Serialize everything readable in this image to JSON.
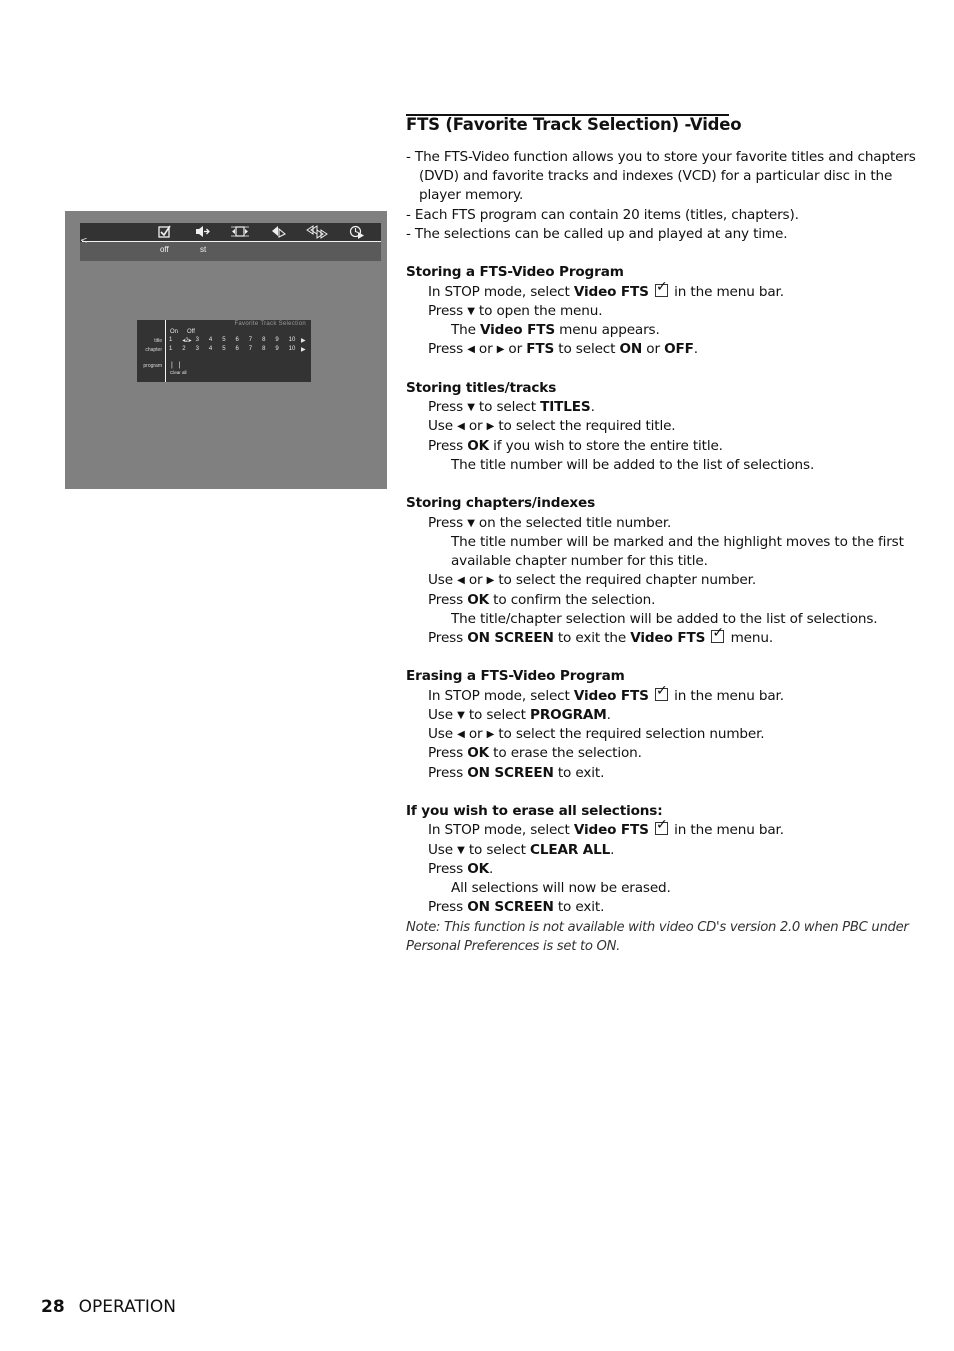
{
  "tv_screen": {
    "menubar": {
      "icons": [
        {
          "name": "video-fts-icon",
          "glyph": "☑",
          "label": "off"
        },
        {
          "name": "sound-icon",
          "glyph": "◀▸",
          "label": "st"
        },
        {
          "name": "frame-icon",
          "glyph": "◂□▸",
          "label": ""
        },
        {
          "name": "angle-icon",
          "glyph": "◀▷",
          "label": ""
        },
        {
          "name": "scan-icon",
          "glyph": "⟪⟫",
          "label": ""
        },
        {
          "name": "time-search-icon",
          "glyph": "◷",
          "label": ""
        }
      ],
      "back_arrow": "<"
    },
    "fts_panel": {
      "heading": "Favorite Track Selection",
      "on_label": "On",
      "off_label": "Off",
      "title_label": "title",
      "chapter_label": "chapter",
      "program_label": "program",
      "title_numbers": [
        "1",
        "◂2▸",
        "3",
        "4",
        "5",
        "6",
        "7",
        "8",
        "9",
        "10"
      ],
      "chapter_numbers": [
        "1",
        "2",
        "3",
        "4",
        "5",
        "6",
        "7",
        "8",
        "9",
        "10"
      ],
      "more_arrow": "▶",
      "program_marks": "| |",
      "clear_all_label": "Clear all"
    }
  },
  "section": {
    "title": "FTS (Favorite Track Selection) -Video",
    "intro": [
      "- The FTS-Video function allows you to store your favorite titles and chapters",
      "(DVD) and favorite tracks and indexes (VCD) for a particular disc in the",
      "player memory.",
      "- Each FTS program can contain 20 items (titles, chapters).",
      "- The selections can be called up and played at any time."
    ]
  },
  "storing_program": {
    "heading": "Storing a FTS-Video Program",
    "l1_pre": "In STOP mode, select ",
    "l1_bold": "Video FTS",
    "l1_post": " in the menu bar.",
    "l2_pre": "Press ",
    "l2_post": " to open the menu.",
    "l3_pre": "The ",
    "l3_bold": "Video FTS",
    "l3_post": " menu appears.",
    "l4_a": "Press ",
    "l4_b": " or ",
    "l4_c": " or ",
    "l4_fts": "FTS",
    "l4_d": " to select ",
    "l4_on": "ON",
    "l4_e": " or ",
    "l4_off": "OFF",
    "l4_f": "."
  },
  "storing_titles": {
    "heading": "Storing titles/tracks",
    "l1_pre": "Press ",
    "l1_post": " to select ",
    "l1_bold": "TITLES",
    "l1_end": ".",
    "l2_a": "Use ",
    "l2_b": " or ",
    "l2_c": " to select the required title.",
    "l3_pre": "Press ",
    "l3_bold": "OK",
    "l3_post": " if you wish to store the entire title.",
    "l4": "The title number will be added to the list of selections."
  },
  "storing_chapters": {
    "heading": "Storing chapters/indexes",
    "l1_pre": "Press ",
    "l1_post": " on the selected title number.",
    "l2": "The title number will be marked and the highlight moves to the first",
    "l3": "available chapter number for this title.",
    "l4_a": "Use ",
    "l4_b": " or ",
    "l4_c": " to select the required chapter number.",
    "l5_pre": "Press ",
    "l5_bold": "OK",
    "l5_post": " to confirm the selection.",
    "l6": "The title/chapter selection will be added to the list of selections.",
    "l7_pre": "Press ",
    "l7_bold": "ON SCREEN",
    "l7_mid": " to exit the ",
    "l7_bold2": "Video FTS",
    "l7_post": " menu."
  },
  "erasing_program": {
    "heading": "Erasing a FTS-Video Program",
    "l1_pre": "In STOP mode, select ",
    "l1_bold": "Video FTS",
    "l1_post": " in the menu bar.",
    "l2_pre": "Use ",
    "l2_post": " to select ",
    "l2_bold": "PROGRAM",
    "l2_end": ".",
    "l3_a": "Use ",
    "l3_b": " or ",
    "l3_c": " to select the required selection number.",
    "l4_pre": "Press ",
    "l4_bold": "OK",
    "l4_post": " to erase the selection.",
    "l5_pre": "Press ",
    "l5_bold": "ON SCREEN",
    "l5_post": " to exit."
  },
  "erase_all": {
    "heading": "If you wish to erase all selections:",
    "l1_pre": "In STOP mode, select  ",
    "l1_bold": "Video FTS",
    "l1_post": " in the menu bar.",
    "l2_pre": "Use ",
    "l2_post": " to select ",
    "l2_bold": "CLEAR ALL",
    "l2_end": ".",
    "l3_pre": "Press ",
    "l3_bold": "OK",
    "l3_end": ".",
    "l4": "All selections will now be erased.",
    "l5_pre": "Press ",
    "l5_bold": "ON SCREEN",
    "l5_post": " to exit."
  },
  "note": [
    "Note: This function is not available with video CD's version 2.0 when PBC under",
    "Personal Preferences is set to ON."
  ],
  "glyphs": {
    "down": "▼",
    "left": "◀",
    "right": "▶"
  },
  "footer": {
    "page_number": "28",
    "section": "OPERATION"
  }
}
